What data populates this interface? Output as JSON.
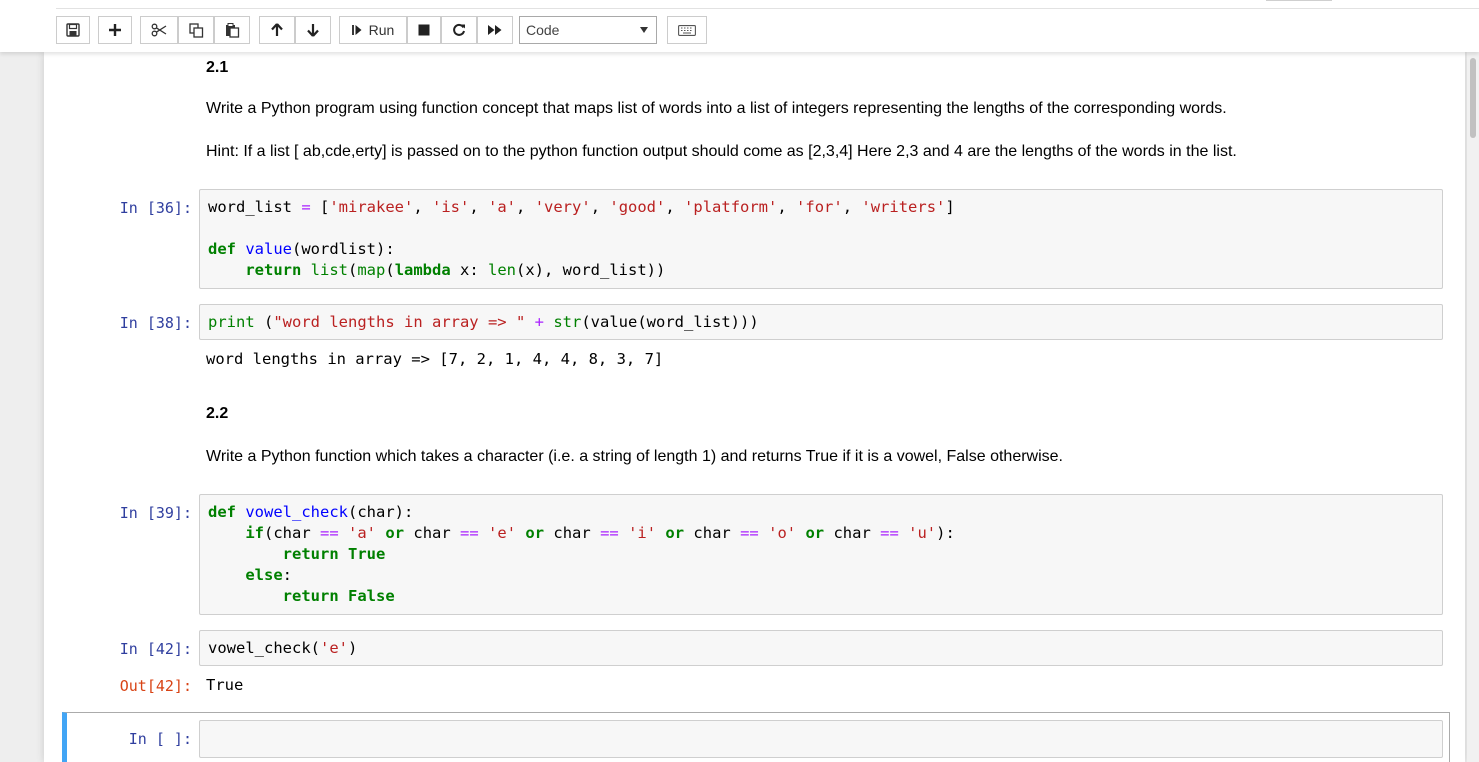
{
  "toolbar": {
    "run_label": "Run",
    "cell_type_selected": "Code",
    "icons": [
      "save-icon",
      "plus-icon",
      "cut-icon",
      "copy-icon",
      "paste-icon",
      "arrow-up-icon",
      "arrow-down-icon",
      "run-icon",
      "stop-icon",
      "restart-icon",
      "fast-forward-icon",
      "keyboard-icon"
    ]
  },
  "section1": {
    "heading": "2.1",
    "text": "Write a Python program using function concept that maps list of words into a list of integers representing the lengths of the corresponding words.",
    "hint": "Hint: If a list [ ab,cde,erty] is passed on to the python function output should come as [2,3,4] Here 2,3 and 4 are the lengths of the words in the list."
  },
  "cells": {
    "c36": {
      "prompt": "In [36]:",
      "l1": {
        "a": "word_list ",
        "b": "=",
        "c": " [",
        "d": "'mirakee'",
        "e": ", ",
        "f": "'is'",
        "g": ", ",
        "h": "'a'",
        "i": ", ",
        "j": "'very'",
        "k": ", ",
        "l": "'good'",
        "m": ", ",
        "n": "'platform'",
        "o": ", ",
        "p": "'for'",
        "q": ", ",
        "r": "'writers'",
        "s": "]"
      },
      "l2": {
        "a": "def",
        "b": " ",
        "c": "value",
        "d": "(wordlist):"
      },
      "l3": {
        "a": "    ",
        "b": "return",
        "c": " ",
        "d": "list",
        "e": "(",
        "f": "map",
        "g": "(",
        "h": "lambda",
        "i": " x: ",
        "j": "len",
        "k": "(x), word_list))"
      }
    },
    "c38": {
      "prompt": "In [38]:",
      "l1": {
        "a": "print",
        "b": " (",
        "c": "\"word lengths in array => \"",
        "d": " ",
        "e": "+",
        "f": " ",
        "g": "str",
        "h": "(value(word_list)))"
      },
      "output": "word lengths in array => [7, 2, 1, 4, 4, 8, 3, 7]"
    },
    "c39": {
      "prompt": "In [39]:",
      "l1": {
        "a": "def",
        "b": " ",
        "c": "vowel_check",
        "d": "(char):"
      },
      "l2": {
        "a": "    ",
        "b": "if",
        "c": "(char ",
        "d": "==",
        "e": " ",
        "f": "'a'",
        "g": " ",
        "h": "or",
        "i": " char ",
        "j": "==",
        "k": " ",
        "l": "'e'",
        "m": " ",
        "n": "or",
        "o": " char ",
        "p": "==",
        "q": " ",
        "r": "'i'",
        "s": " ",
        "t": "or",
        "u": " char ",
        "v": "==",
        "w": " ",
        "x": "'o'",
        "y": " ",
        "z": "or",
        "aa": " char ",
        "ab": "==",
        "ac": " ",
        "ad": "'u'",
        "ae": "):"
      },
      "l3": {
        "a": "        ",
        "b": "return",
        "c": " ",
        "d": "True"
      },
      "l4": {
        "a": "    ",
        "b": "else",
        "c": ":"
      },
      "l5": {
        "a": "        ",
        "b": "return",
        "c": " ",
        "d": "False"
      }
    },
    "c42": {
      "prompt": "In [42]:",
      "l1": {
        "a": "vowel_check(",
        "b": "'e'",
        "c": ")"
      },
      "out_prompt": "Out[42]:",
      "output": "True"
    },
    "empty": {
      "prompt": "In [ ]:"
    }
  },
  "section2": {
    "heading": "2.2",
    "text": "Write a Python function which takes a character (i.e. a string of length 1) and returns True if it is a vowel, False otherwise."
  },
  "colors": {
    "prompt_in": "#303f9f",
    "prompt_out": "#d84315",
    "keyword": "#008000",
    "string": "#ba2121",
    "operator": "#aa22ff",
    "function_name": "#0000ff",
    "selected_cell_bar": "#42a5f5"
  }
}
